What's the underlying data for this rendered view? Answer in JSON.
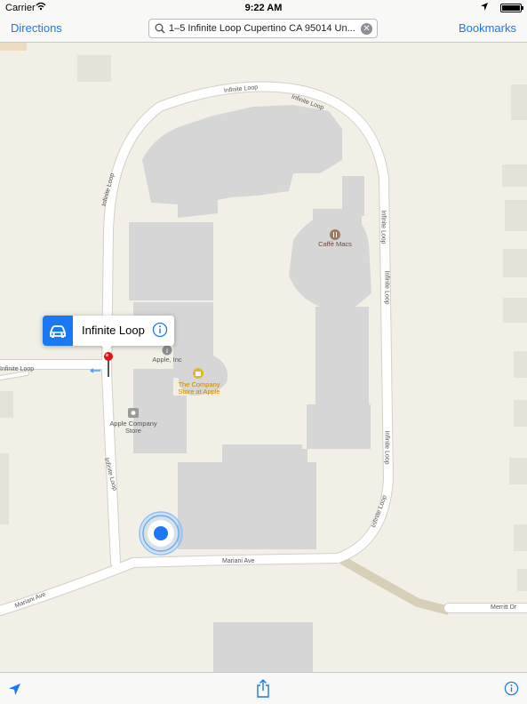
{
  "status_bar": {
    "carrier": "Carrier",
    "time": "9:22 AM"
  },
  "nav": {
    "directions_label": "Directions",
    "bookmarks_label": "Bookmarks",
    "search_value": "1–5 Infinite Loop Cupertino CA 95014 Un..."
  },
  "callout": {
    "title": "Infinite Loop"
  },
  "map": {
    "road_labels": {
      "loop_top": "Infinite Loop",
      "loop_top2": "Infinite Loop",
      "loop_left": "Infinite Loop",
      "loop_right1": "Infinite Loop",
      "loop_right2": "Infinite Loop",
      "loop_right3": "Infinite Loop",
      "loop_right4": "Infinite Loop",
      "loop_right5": "Infinite Loop",
      "loop_west": "Infinite Loop",
      "loop_lower_left": "Infinite Loop",
      "mariani_bottom": "Mariani Ave",
      "mariani_left": "Mariani Ave",
      "merritt": "Merritt Dr"
    },
    "poi": {
      "apple_inc": "Apple, Inc",
      "company_store": "The Company\nStore at Apple",
      "apple_company_store": "Apple Company\nStore",
      "caffe_macs": "Caffè Macs"
    }
  },
  "colors": {
    "accent": "#1a78f2",
    "land": "#f2efe6",
    "building": "#d6d6d6",
    "road": "#ffffff"
  },
  "icons": {
    "location_arrow": "location-arrow-icon",
    "share": "share-icon",
    "info": "info-icon"
  }
}
